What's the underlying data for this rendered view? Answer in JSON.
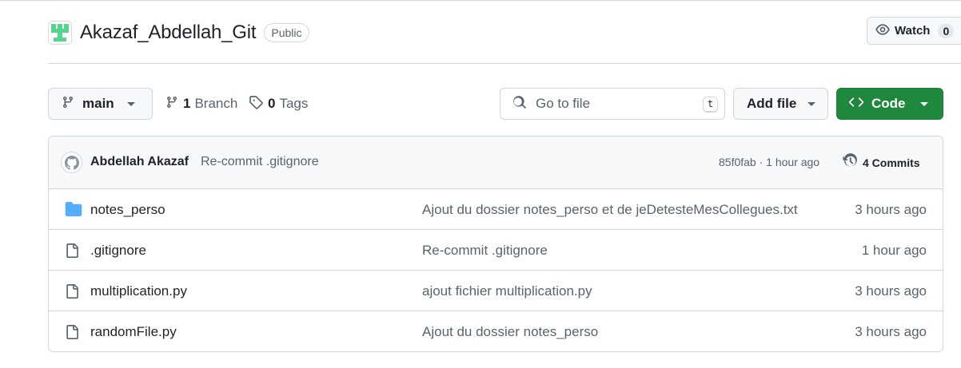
{
  "repo": {
    "name": "Akazaf_Abdellah_Git",
    "visibility": "Public"
  },
  "watch": {
    "label": "Watch",
    "count": "0"
  },
  "toolbar": {
    "branch": "main",
    "branches_count": "1",
    "branches_label": "Branch",
    "tags_count": "0",
    "tags_label": "Tags",
    "search_placeholder": "Go to file",
    "search_shortcut": "t",
    "add_file_label": "Add file",
    "code_label": "Code"
  },
  "latest_commit": {
    "author": "Abdellah Akazaf",
    "message": "Re-commit .gitignore",
    "hash_and_time": "85f0fab · 1 hour ago",
    "commits_label": "4 Commits"
  },
  "files": [
    {
      "type": "folder",
      "icon": "folder-icon",
      "name": "notes_perso",
      "message": "Ajout du dossier notes_perso et de jeDetesteMesCollegues.txt",
      "date": "3 hours ago"
    },
    {
      "type": "file",
      "icon": "file-icon",
      "name": ".gitignore",
      "message": "Re-commit .gitignore",
      "date": "1 hour ago"
    },
    {
      "type": "file",
      "icon": "file-icon",
      "name": "multiplication.py",
      "message": "ajout fichier multiplication.py",
      "date": "3 hours ago"
    },
    {
      "type": "file",
      "icon": "file-icon",
      "name": "randomFile.py",
      "message": "Ajout du dossier notes_perso",
      "date": "3 hours ago"
    }
  ],
  "colors": {
    "accent_green": "#1f883d",
    "folder_blue": "#54aeff",
    "muted_text": "#59636e",
    "border": "#d0d7de",
    "avatar_green": "#57d58c"
  }
}
